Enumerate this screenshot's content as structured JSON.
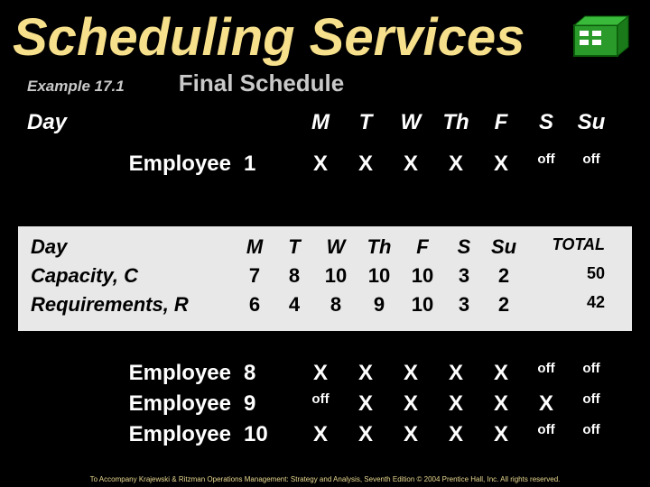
{
  "title": "Scheduling Services",
  "example_label": "Example 17.1",
  "section_title": "Final Schedule",
  "top": {
    "day_word": "Day",
    "days": {
      "m": "M",
      "t": "T",
      "w": "W",
      "th": "Th",
      "f": "F",
      "s": "S",
      "su": "Su"
    }
  },
  "emp1": {
    "label": "Employee",
    "num": "1",
    "cells": {
      "m": "X",
      "t": "X",
      "w": "X",
      "th": "X",
      "f": "X",
      "s": "off",
      "su": "off"
    }
  },
  "overlay": {
    "day_word": "Day",
    "days": {
      "m": "M",
      "t": "T",
      "w": "W",
      "th": "Th",
      "f": "F",
      "s": "S",
      "su": "Su"
    },
    "total_label": "TOTAL",
    "capacity": {
      "label": "Capacity, C",
      "m": "7",
      "t": "8",
      "w": "10",
      "th": "10",
      "f": "10",
      "s": "3",
      "su": "2",
      "total": "50"
    },
    "requirements": {
      "label": "Requirements, R",
      "m": "6",
      "t": "4",
      "w": "8",
      "th": "9",
      "f": "10",
      "s": "3",
      "su": "2",
      "total": "42"
    }
  },
  "bottom": {
    "r8": {
      "label": "Employee",
      "num": "8",
      "m": "X",
      "t": "X",
      "w": "X",
      "th": "X",
      "f": "X",
      "s": "off",
      "su": "off"
    },
    "r9": {
      "label": "Employee",
      "num": "9",
      "m": "off",
      "t": "X",
      "w": "X",
      "th": "X",
      "f": "X",
      "s": "X",
      "su": "off"
    },
    "r10": {
      "label": "Employee",
      "num": "10",
      "m": "X",
      "t": "X",
      "w": "X",
      "th": "X",
      "f": "X",
      "s": "off",
      "su": "off"
    }
  },
  "footer": "To Accompany Krajewski & Ritzman Operations Management: Strategy and Analysis, Seventh Edition © 2004 Prentice Hall, Inc. All rights reserved.",
  "icon": {
    "box_fill": "#2a9a2a",
    "box_stroke": "#7a4a1a",
    "bg": "#8a5a2a"
  }
}
